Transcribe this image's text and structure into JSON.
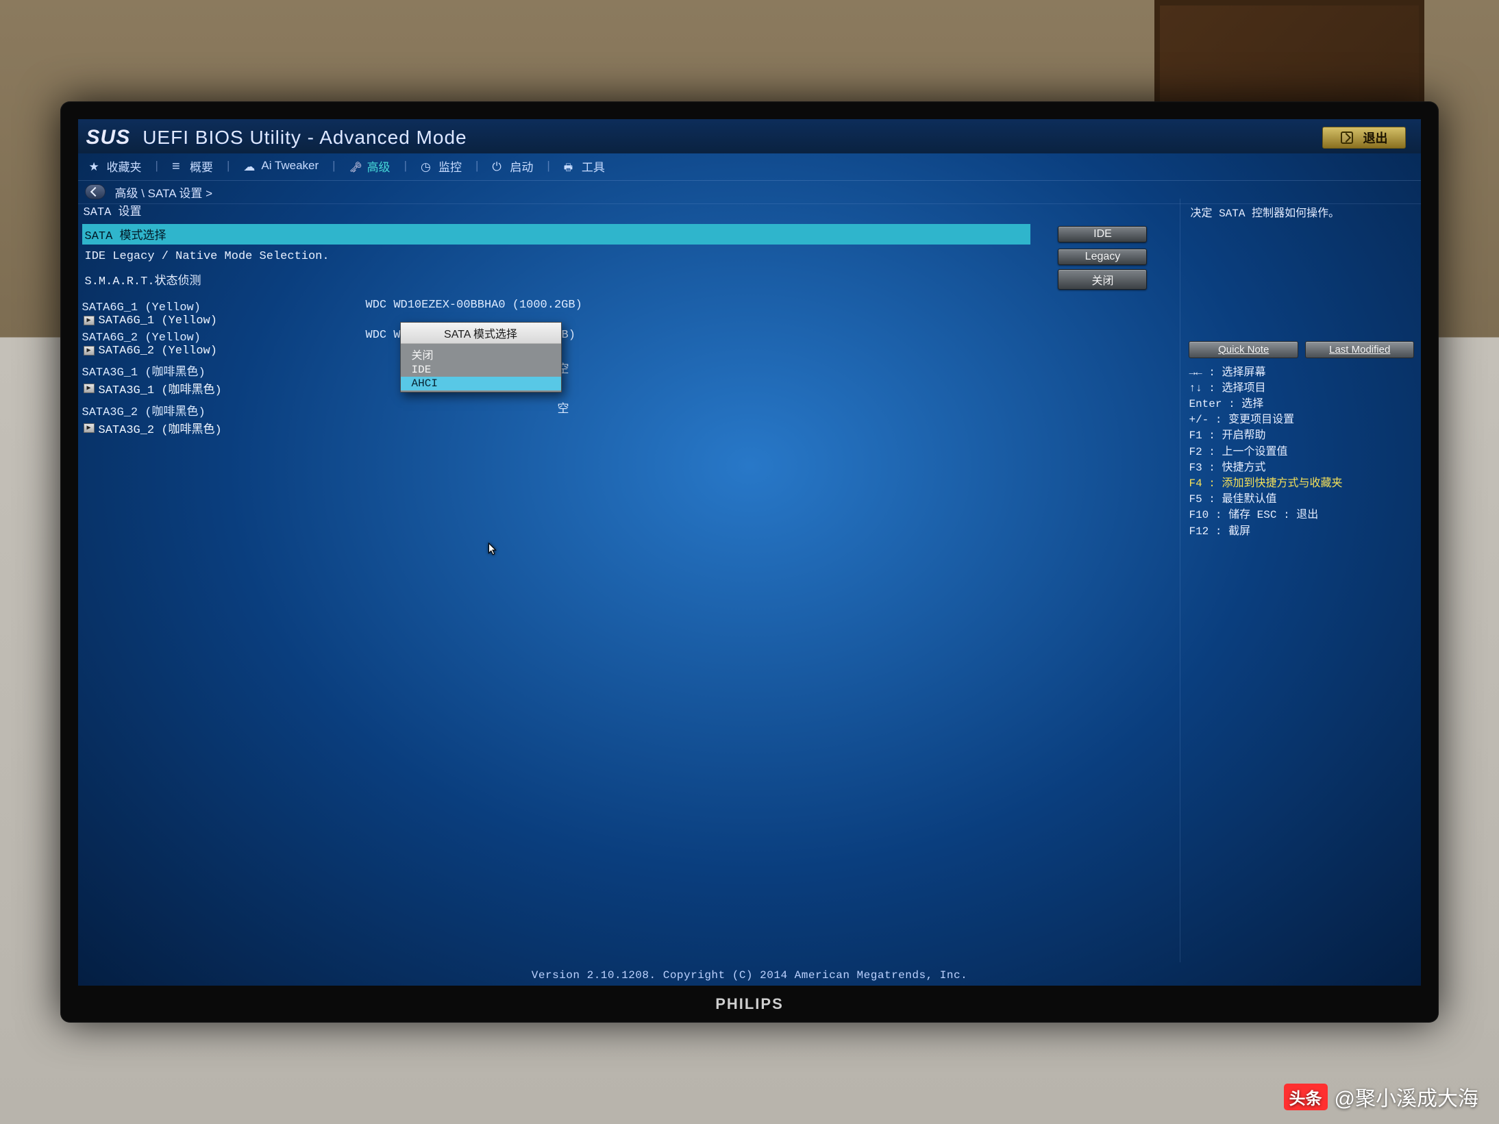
{
  "header": {
    "brand": "SUS",
    "title": "UEFI BIOS Utility - Advanced Mode",
    "exit_label": "退出"
  },
  "menu": {
    "items": [
      {
        "label": "收藏夹",
        "icon": "star"
      },
      {
        "label": "概要",
        "icon": "list"
      },
      {
        "label": "Ai Tweaker",
        "icon": "cloud"
      },
      {
        "label": "高级",
        "icon": "lock",
        "active": true
      },
      {
        "label": "监控",
        "icon": "gauge"
      },
      {
        "label": "启动",
        "icon": "power"
      },
      {
        "label": "工具",
        "icon": "tool"
      }
    ]
  },
  "breadcrumb": "高级 \\ SATA 设置 >",
  "section_title": "SATA 设置",
  "settings": [
    {
      "label": "SATA 模式选择",
      "value": "IDE",
      "selected": true
    },
    {
      "label": "IDE Legacy / Native Mode Selection.",
      "value": "Legacy"
    },
    {
      "label": "S.M.A.R.T.状态侦测",
      "value": "关闭"
    }
  ],
  "devices": [
    {
      "port": "SATA6G_1 (Yellow)",
      "sub": "SATA6G_1 (Yellow)",
      "value": "WDC WD10EZEX-00BBHA0 (1000.2GB)"
    },
    {
      "port": "SATA6G_2 (Yellow)",
      "sub": "SATA6G_2 (Yellow)",
      "value": "WDC W"
    },
    {
      "port": "SATA3G_1 (咖啡黑色)",
      "sub": "SATA3G_1 (咖啡黑色)",
      "value": "空"
    },
    {
      "port": "SATA3G_2 (咖啡黑色)",
      "sub": "SATA3G_2 (咖啡黑色)",
      "value": "空"
    }
  ],
  "popup": {
    "title": "SATA 模式选择",
    "options": [
      {
        "label": "关闭",
        "selected": false
      },
      {
        "label": "IDE",
        "selected": false
      },
      {
        "label": "AHCI",
        "selected": true
      }
    ]
  },
  "help": {
    "description": "决定 SATA 控制器如何操作。",
    "quick_note": "Quick Note",
    "last_modified": "Last Modified",
    "keys": [
      "→← : 选择屏幕",
      "↑↓ : 选择项目",
      "Enter : 选择",
      "+/- : 变更项目设置",
      "F1 : 开启帮助",
      "F2 : 上一个设置值",
      "F3 : 快捷方式",
      "F4 : 添加到快捷方式与收藏夹",
      "F5 : 最佳默认值",
      "F10 : 储存   ESC : 退出",
      "F12 : 截屏"
    ],
    "highlight_index": 7
  },
  "footer": "Version 2.10.1208. Copyright (C) 2014 American Megatrends, Inc.",
  "monitor_brand": "PHILIPS",
  "watermark": {
    "badge": "头条",
    "text": "@聚小溪成大海"
  },
  "device_value_suffixes": {
    "1": "B)"
  }
}
